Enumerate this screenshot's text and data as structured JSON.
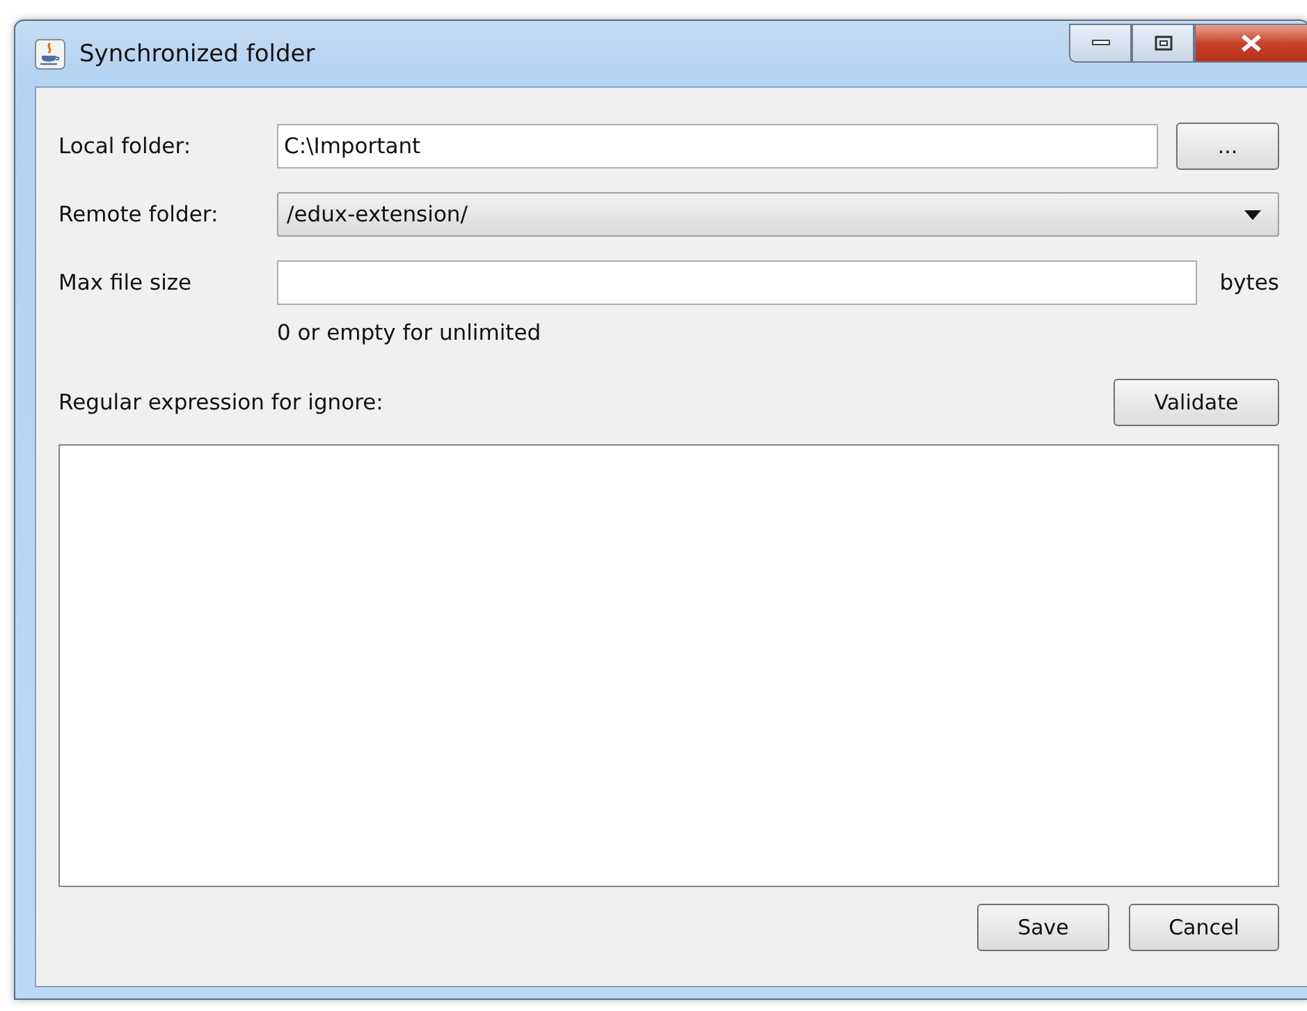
{
  "window": {
    "title": "Synchronized folder"
  },
  "local_folder": {
    "label": "Local folder:",
    "value": "C:\\Important",
    "browse_button": "..."
  },
  "remote_folder": {
    "label": "Remote folder:",
    "value": "/edux-extension/"
  },
  "max_file_size": {
    "label": "Max file size",
    "unit": "bytes",
    "hint": "0 or empty for unlimited"
  },
  "ignore_regex": {
    "label": "Regular expression for ignore:",
    "validate_button": "Validate"
  },
  "buttons": [
    "Save",
    "Cancel"
  ]
}
